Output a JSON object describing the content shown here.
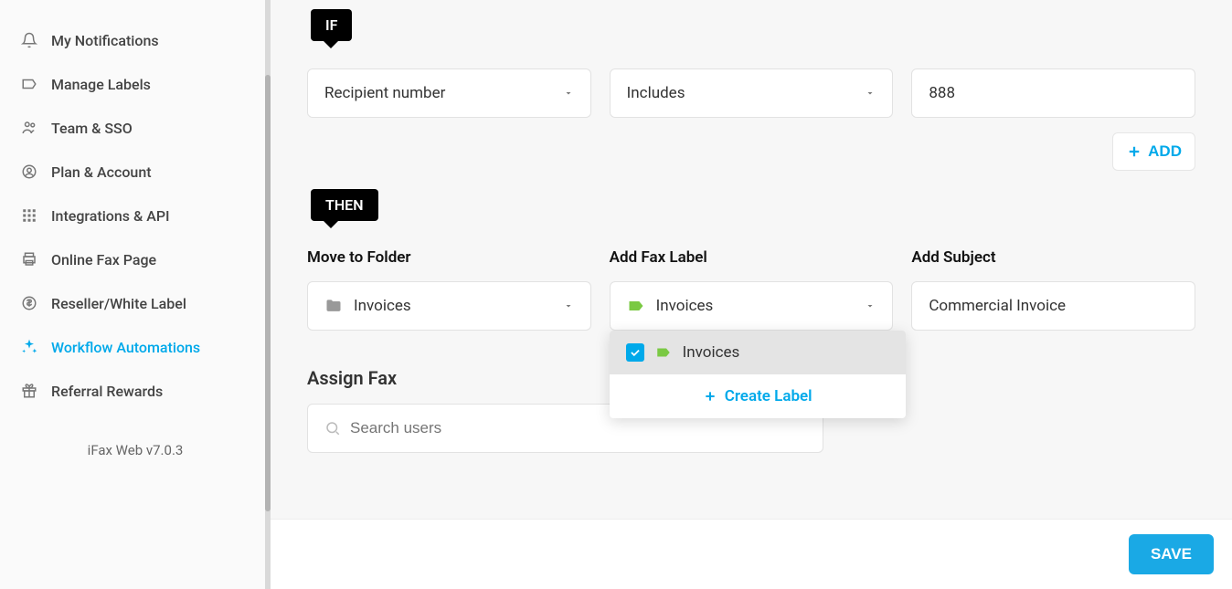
{
  "sidebar": {
    "items": [
      {
        "icon": "bell",
        "label": "My Notifications"
      },
      {
        "icon": "tag-outline",
        "label": "Manage Labels"
      },
      {
        "icon": "users",
        "label": "Team & SSO"
      },
      {
        "icon": "user-circle",
        "label": "Plan & Account"
      },
      {
        "icon": "grid",
        "label": "Integrations & API"
      },
      {
        "icon": "printer",
        "label": "Online Fax Page"
      },
      {
        "icon": "dollar",
        "label": "Reseller/White Label"
      },
      {
        "icon": "sparkle",
        "label": "Workflow Automations",
        "active": true
      },
      {
        "icon": "gift",
        "label": "Referral Rewards"
      }
    ],
    "version": "iFax Web v7.0.3"
  },
  "main": {
    "if_label": "IF",
    "condition": {
      "field": "Recipient number",
      "operator": "Includes",
      "value": "888"
    },
    "add_btn": "ADD",
    "then_label": "THEN",
    "move_folder": {
      "label": "Move to Folder",
      "value": "Invoices"
    },
    "add_label": {
      "label": "Add Fax Label",
      "value": "Invoices"
    },
    "add_subject": {
      "label": "Add Subject",
      "value": "Commercial Invoice"
    },
    "assign_heading": "Assign Fax",
    "search_placeholder": "Search users",
    "dropdown": {
      "option": "Invoices",
      "create": "Create Label"
    },
    "save": "SAVE"
  }
}
